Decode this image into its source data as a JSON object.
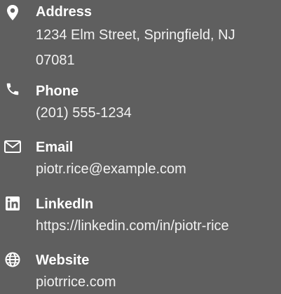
{
  "contact": {
    "address": {
      "label": "Address",
      "line1": "1234 Elm Street, Springfield, NJ",
      "line2": "07081",
      "icon": "map-marker-icon"
    },
    "phone": {
      "label": "Phone",
      "value": "(201) 555-1234",
      "icon": "phone-icon"
    },
    "email": {
      "label": "Email",
      "value": "piotr.rice@example.com",
      "icon": "envelope-icon"
    },
    "linkedin": {
      "label": "LinkedIn",
      "value": "https://linkedin.com/in/piotr-rice",
      "icon": "linkedin-icon"
    },
    "website": {
      "label": "Website",
      "value": "piotrrice.com",
      "icon": "globe-icon"
    }
  },
  "colors": {
    "background": "#5f5f5f",
    "text": "#ffffff"
  }
}
